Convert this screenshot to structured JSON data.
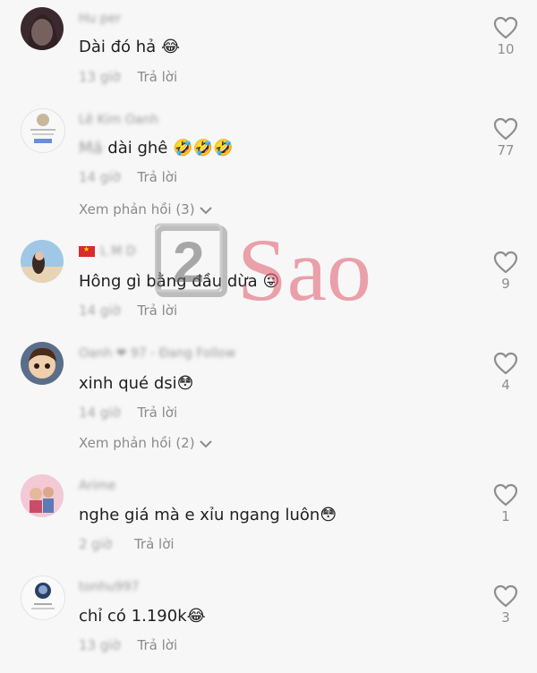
{
  "comments": [
    {
      "user": "Hu per",
      "text": "Dài đó hả",
      "emoji": "😂",
      "time": "13 giờ",
      "reply": "Trả lời",
      "likes": "10"
    },
    {
      "user": "Lê Kim Oanh",
      "prefix": "Má",
      "text": "dài ghê",
      "emoji": "🤣🤣🤣",
      "time": "14 giờ",
      "reply": "Trả lời",
      "likes": "77",
      "view_replies": "Xem phản hồi (3)"
    },
    {
      "user": "L M D",
      "text": "Hông gì bằng đầu dừa",
      "emoji": "😛",
      "time": "14 giờ",
      "reply": "Trả lời",
      "likes": "9"
    },
    {
      "user": "Oanh ❤ 97 - Đang Follow",
      "text": "xinh qué dsi",
      "emoji": "😳",
      "time": "14 giờ",
      "reply": "Trả lời",
      "likes": "4",
      "view_replies": "Xem phản hồi (2)"
    },
    {
      "user": "Arime",
      "text": "nghe giá mà e xỉu ngang luôn",
      "emoji": "😳",
      "time": "2 giờ",
      "reply": "Trả lời",
      "likes": "1"
    },
    {
      "user": "tonhu997",
      "text": "chỉ có 1.190k",
      "emoji": "😂",
      "time": "13 giờ",
      "reply": "Trả lời",
      "likes": "3"
    }
  ],
  "watermark": {
    "number": "2",
    "text": "Sao"
  },
  "colors": {
    "watermark": "#e05a6a",
    "heart": "#8e8e8e"
  }
}
